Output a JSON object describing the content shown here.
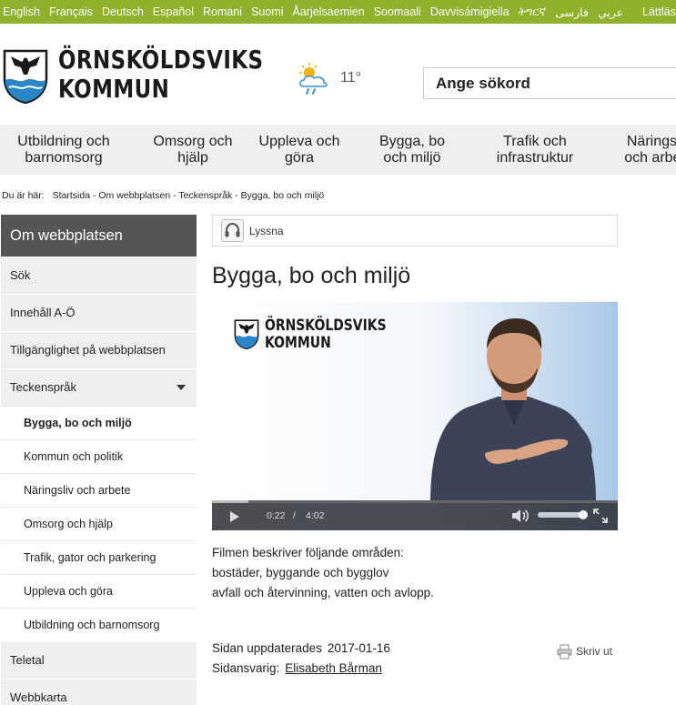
{
  "languages": [
    "English",
    "Français",
    "Deutsch",
    "Español",
    "Romani",
    "Suomi",
    "Åarjelsaemien",
    "Soomaali",
    "Davvisámigiella",
    "ትግርኛ",
    "فارسی",
    "عربي"
  ],
  "easy_read": "Lättläst",
  "header": {
    "logo_line1": "ÖRNSKÖLDSVIKS",
    "logo_line2": "KOMMUN",
    "temperature": "11°",
    "weather_icon": "sun-cloud-rain-icon",
    "search_placeholder": "Ange sökord"
  },
  "main_nav": [
    {
      "label": "Utbildning och barnomsorg"
    },
    {
      "label": "Omsorg och hjälp"
    },
    {
      "label": "Uppleva och göra"
    },
    {
      "label": "Bygga, bo och miljö"
    },
    {
      "label": "Trafik och infrastruktur"
    },
    {
      "label": "Näringsliv och arbete"
    }
  ],
  "breadcrumb": {
    "label": "Du är här:",
    "items": [
      "Startsida",
      "Om webbplatsen",
      "Teckenspråk",
      "Bygga, bo och miljö"
    ],
    "separator": " - "
  },
  "side_menu": {
    "title": "Om webbplatsen",
    "items_top": [
      "Sök",
      "Innehåll A-Ö",
      "Tillgänglighet på webbplatsen"
    ],
    "expanded_item": "Teckenspråk",
    "sub_items": [
      "Bygga, bo och miljö",
      "Kommun och politik",
      "Näringsliv och arbete",
      "Omsorg och hjälp",
      "Trafik, gator och parkering",
      "Uppleva och göra",
      "Utbildning och barnomsorg"
    ],
    "active_sub_index": 0,
    "items_bottom": [
      "Teletal",
      "Webbkarta"
    ]
  },
  "content": {
    "listen_label": "Lyssna",
    "title": "Bygga, bo och miljö",
    "video": {
      "logo_line1": "ÖRNSKÖLDSVIKS",
      "logo_line2": "KOMMUN",
      "current_time": "0:22",
      "separator": "/",
      "duration": "4:02",
      "progress_fraction": 0.09,
      "volume_fraction": 1.0
    },
    "description_lines": [
      "Filmen beskriver följande områden:",
      "bostäder, byggande och bygglov",
      "avfall och återvinning, vatten och avlopp."
    ],
    "updated_label": "Sidan uppdaterades",
    "updated_date": "2017-01-16",
    "responsible_label": "Sidansvarig:",
    "responsible_name": "Elisabeth Bårman",
    "print_label": "Skriv ut"
  },
  "colors": {
    "language_bar": "#8fb12b",
    "side_header": "#555555",
    "nav_background": "#efefef"
  }
}
